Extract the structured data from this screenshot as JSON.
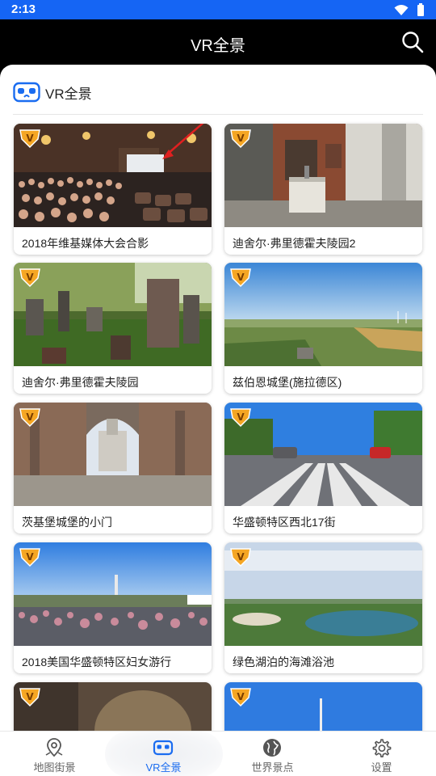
{
  "status": {
    "time": "2:13",
    "icons": [
      "wifi-icon",
      "battery-icon"
    ]
  },
  "app_bar": {
    "title": "VR全景",
    "search_icon": "search-icon"
  },
  "section": {
    "title": "VR全景",
    "icon": "vr-headset-icon"
  },
  "cards": [
    {
      "caption": "2018年维基媒体大会合影"
    },
    {
      "caption": "迪舍尔·弗里德霍夫陵园2"
    },
    {
      "caption": "迪舍尔·弗里德霍夫陵园"
    },
    {
      "caption": "兹伯恩城堡(施拉德区)"
    },
    {
      "caption": "茨基堡城堡的小门"
    },
    {
      "caption": "华盛顿特区西北17街"
    },
    {
      "caption": "2018美国华盛顿特区妇女游行"
    },
    {
      "caption": "绿色湖泊的海滩浴池"
    },
    {
      "caption": ""
    },
    {
      "caption": ""
    }
  ],
  "badge_letter": "V",
  "nav": [
    {
      "label": "地图街景",
      "icon": "map-pin-icon",
      "active": false
    },
    {
      "label": "VR全景",
      "icon": "vr-headset-icon",
      "active": true
    },
    {
      "label": "世界景点",
      "icon": "globe-icon",
      "active": false
    },
    {
      "label": "设置",
      "icon": "gear-icon",
      "active": false
    }
  ],
  "colors": {
    "status_bar": "#1565f4",
    "accent": "#1a6cf0",
    "badge": "#f5a623"
  }
}
